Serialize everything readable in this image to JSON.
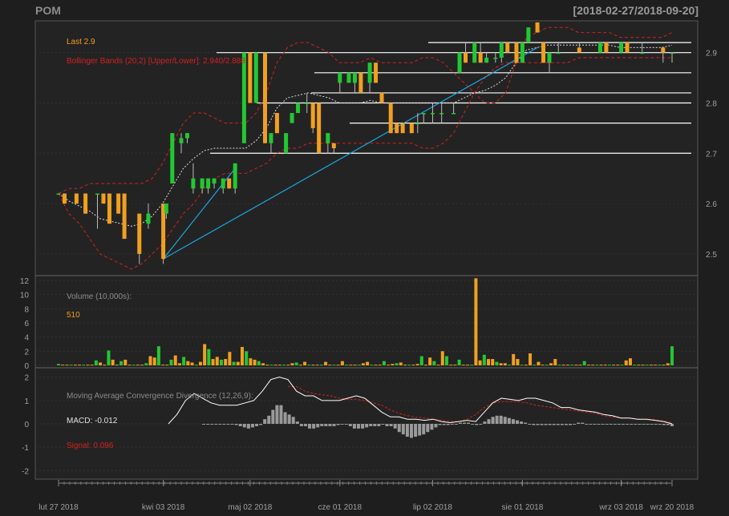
{
  "header": {
    "symbol": "POM",
    "range": "[2018-02-27/2018-09-20]"
  },
  "price_panel": {
    "last_label": "Last 2.9",
    "bb_label": "Bollinger Bands (20,2) [Upper/Lower]: 2.940/2.888",
    "yticks": [
      "2.5",
      "2.6",
      "2.7",
      "2.8",
      "2.9"
    ]
  },
  "volume_panel": {
    "title": "Volume (10,000s):",
    "value": "510",
    "yticks": [
      "0",
      "2",
      "4",
      "6",
      "8",
      "10",
      "12"
    ]
  },
  "macd_panel": {
    "title": "Moving Average Convergence Divergence (12,26,9):",
    "macd_label": "MACD: -0.012",
    "signal_label": "Signal: 0.096",
    "yticks": [
      "-2",
      "-1",
      "0",
      "1",
      "2"
    ]
  },
  "xaxis": {
    "labels": [
      "lut 27 2018",
      "kwi 03 2018",
      "maj 02 2018",
      "cze 01 2018",
      "lip 02 2018",
      "sie 01 2018",
      "wrz 03 2018",
      "wrz 20 2018"
    ]
  },
  "colors": {
    "up": "#22c832",
    "down": "#f0a020",
    "bb": "#d42020",
    "trend": "#1aa8e0",
    "bg": "#1e1e1e",
    "panel": "#232323",
    "axis": "#a0a0a0"
  },
  "chart_data": [
    {
      "type": "candlestick",
      "title": "POM",
      "ylim": [
        2.46,
        2.96
      ],
      "candles": [
        {
          "date": "2018-02-27",
          "o": 2.62,
          "h": 2.62,
          "l": 2.62,
          "c": 2.62
        },
        {
          "date": "2018-03-01",
          "o": 2.62,
          "h": 2.62,
          "l": 2.6,
          "c": 2.6
        },
        {
          "date": "2018-03-05",
          "o": 2.62,
          "h": 2.62,
          "l": 2.6,
          "c": 2.6
        },
        {
          "date": "2018-03-08",
          "o": 2.62,
          "h": 2.62,
          "l": 2.58,
          "c": 2.58
        },
        {
          "date": "2018-03-12",
          "o": 2.62,
          "h": 2.62,
          "l": 2.55,
          "c": 2.62
        },
        {
          "date": "2018-03-14",
          "o": 2.62,
          "h": 2.62,
          "l": 2.6,
          "c": 2.6
        },
        {
          "date": "2018-03-16",
          "o": 2.62,
          "h": 2.62,
          "l": 2.56,
          "c": 2.56
        },
        {
          "date": "2018-03-19",
          "o": 2.62,
          "h": 2.62,
          "l": 2.58,
          "c": 2.58
        },
        {
          "date": "2018-03-21",
          "o": 2.62,
          "h": 2.62,
          "l": 2.53,
          "c": 2.53
        },
        {
          "date": "2018-03-26",
          "o": 2.58,
          "h": 2.58,
          "l": 2.48,
          "c": 2.5
        },
        {
          "date": "2018-03-29",
          "o": 2.56,
          "h": 2.6,
          "l": 2.55,
          "c": 2.58
        },
        {
          "date": "2018-04-03",
          "o": 2.6,
          "h": 2.6,
          "l": 2.48,
          "c": 2.49
        },
        {
          "date": "2018-04-04",
          "o": 2.58,
          "h": 2.6,
          "l": 2.57,
          "c": 2.6
        },
        {
          "date": "2018-04-06",
          "o": 2.64,
          "h": 2.74,
          "l": 2.64,
          "c": 2.74
        },
        {
          "date": "2018-04-09",
          "o": 2.72,
          "h": 2.74,
          "l": 2.7,
          "c": 2.73
        },
        {
          "date": "2018-04-11",
          "o": 2.73,
          "h": 2.74,
          "l": 2.72,
          "c": 2.74
        },
        {
          "date": "2018-04-13",
          "o": 2.63,
          "h": 2.68,
          "l": 2.62,
          "c": 2.65
        },
        {
          "date": "2018-04-16",
          "o": 2.63,
          "h": 2.65,
          "l": 2.62,
          "c": 2.65
        },
        {
          "date": "2018-04-18",
          "o": 2.63,
          "h": 2.65,
          "l": 2.62,
          "c": 2.65
        },
        {
          "date": "2018-04-20",
          "o": 2.64,
          "h": 2.65,
          "l": 2.63,
          "c": 2.65
        },
        {
          "date": "2018-04-23",
          "o": 2.63,
          "h": 2.65,
          "l": 2.62,
          "c": 2.65
        },
        {
          "date": "2018-04-25",
          "o": 2.65,
          "h": 2.65,
          "l": 2.63,
          "c": 2.63
        },
        {
          "date": "2018-04-27",
          "o": 2.63,
          "h": 2.68,
          "l": 2.62,
          "c": 2.68
        },
        {
          "date": "2018-04-30",
          "o": 2.72,
          "h": 2.9,
          "l": 2.72,
          "c": 2.9
        },
        {
          "date": "2018-05-02",
          "o": 2.9,
          "h": 2.9,
          "l": 2.8,
          "c": 2.8
        },
        {
          "date": "2018-05-04",
          "o": 2.8,
          "h": 2.9,
          "l": 2.8,
          "c": 2.9
        },
        {
          "date": "2018-05-07",
          "o": 2.9,
          "h": 2.9,
          "l": 2.72,
          "c": 2.72
        },
        {
          "date": "2018-05-09",
          "o": 2.72,
          "h": 2.74,
          "l": 2.7,
          "c": 2.74
        },
        {
          "date": "2018-05-11",
          "o": 2.78,
          "h": 2.78,
          "l": 2.74,
          "c": 2.74
        },
        {
          "date": "2018-05-14",
          "o": 2.7,
          "h": 2.74,
          "l": 2.7,
          "c": 2.74
        },
        {
          "date": "2018-05-16",
          "o": 2.76,
          "h": 2.78,
          "l": 2.76,
          "c": 2.78
        },
        {
          "date": "2018-05-18",
          "o": 2.78,
          "h": 2.8,
          "l": 2.78,
          "c": 2.8
        },
        {
          "date": "2018-05-21",
          "o": 2.8,
          "h": 2.82,
          "l": 2.78,
          "c": 2.8
        },
        {
          "date": "2018-05-23",
          "o": 2.8,
          "h": 2.8,
          "l": 2.74,
          "c": 2.75
        },
        {
          "date": "2018-05-25",
          "o": 2.8,
          "h": 2.8,
          "l": 2.7,
          "c": 2.7
        },
        {
          "date": "2018-05-28",
          "o": 2.72,
          "h": 2.74,
          "l": 2.7,
          "c": 2.74
        },
        {
          "date": "2018-05-30",
          "o": 2.72,
          "h": 2.72,
          "l": 2.7,
          "c": 2.71
        },
        {
          "date": "2018-06-01",
          "o": 2.84,
          "h": 2.86,
          "l": 2.82,
          "c": 2.86
        },
        {
          "date": "2018-06-04",
          "o": 2.84,
          "h": 2.86,
          "l": 2.84,
          "c": 2.86
        },
        {
          "date": "2018-06-06",
          "o": 2.84,
          "h": 2.86,
          "l": 2.82,
          "c": 2.86
        },
        {
          "date": "2018-06-08",
          "o": 2.86,
          "h": 2.86,
          "l": 2.82,
          "c": 2.82
        },
        {
          "date": "2018-06-11",
          "o": 2.84,
          "h": 2.88,
          "l": 2.82,
          "c": 2.88
        },
        {
          "date": "2018-06-13",
          "o": 2.88,
          "h": 2.88,
          "l": 2.84,
          "c": 2.84
        },
        {
          "date": "2018-06-15",
          "o": 2.82,
          "h": 2.82,
          "l": 2.8,
          "c": 2.8
        },
        {
          "date": "2018-06-18",
          "o": 2.8,
          "h": 2.8,
          "l": 2.74,
          "c": 2.74
        },
        {
          "date": "2018-06-20",
          "o": 2.76,
          "h": 2.76,
          "l": 2.74,
          "c": 2.74
        },
        {
          "date": "2018-06-22",
          "o": 2.76,
          "h": 2.76,
          "l": 2.74,
          "c": 2.74
        },
        {
          "date": "2018-06-25",
          "o": 2.76,
          "h": 2.76,
          "l": 2.74,
          "c": 2.74
        },
        {
          "date": "2018-06-27",
          "o": 2.76,
          "h": 2.78,
          "l": 2.74,
          "c": 2.76
        },
        {
          "date": "2018-06-29",
          "o": 2.78,
          "h": 2.78,
          "l": 2.76,
          "c": 2.78
        },
        {
          "date": "2018-07-02",
          "o": 2.78,
          "h": 2.8,
          "l": 2.76,
          "c": 2.78
        },
        {
          "date": "2018-07-05",
          "o": 2.78,
          "h": 2.8,
          "l": 2.76,
          "c": 2.78
        },
        {
          "date": "2018-07-09",
          "o": 2.78,
          "h": 2.8,
          "l": 2.78,
          "c": 2.78
        },
        {
          "date": "2018-07-11",
          "o": 2.86,
          "h": 2.9,
          "l": 2.86,
          "c": 2.9
        },
        {
          "date": "2018-07-13",
          "o": 2.9,
          "h": 2.92,
          "l": 2.88,
          "c": 2.88
        },
        {
          "date": "2018-07-16",
          "o": 2.88,
          "h": 2.92,
          "l": 2.88,
          "c": 2.92
        },
        {
          "date": "2018-07-18",
          "o": 2.9,
          "h": 2.92,
          "l": 2.88,
          "c": 2.88
        },
        {
          "date": "2018-07-20",
          "o": 2.88,
          "h": 2.9,
          "l": 2.88,
          "c": 2.89
        },
        {
          "date": "2018-07-23",
          "o": 2.89,
          "h": 2.9,
          "l": 2.88,
          "c": 2.89
        },
        {
          "date": "2018-07-25",
          "o": 2.89,
          "h": 2.92,
          "l": 2.88,
          "c": 2.92
        },
        {
          "date": "2018-07-27",
          "o": 2.92,
          "h": 2.92,
          "l": 2.9,
          "c": 2.9
        },
        {
          "date": "2018-07-30",
          "o": 2.92,
          "h": 2.92,
          "l": 2.88,
          "c": 2.88
        },
        {
          "date": "2018-08-01",
          "o": 2.88,
          "h": 2.92,
          "l": 2.88,
          "c": 2.92
        },
        {
          "date": "2018-08-03",
          "o": 2.92,
          "h": 2.95,
          "l": 2.92,
          "c": 2.95
        },
        {
          "date": "2018-08-06",
          "o": 2.96,
          "h": 2.96,
          "l": 2.94,
          "c": 2.94
        },
        {
          "date": "2018-08-08",
          "o": 2.92,
          "h": 2.92,
          "l": 2.88,
          "c": 2.88
        },
        {
          "date": "2018-08-10",
          "o": 2.88,
          "h": 2.9,
          "l": 2.86,
          "c": 2.9
        },
        {
          "date": "2018-08-13",
          "o": 2.9,
          "h": 2.92,
          "l": 2.9,
          "c": 2.9
        },
        {
          "date": "2018-08-20",
          "o": 2.91,
          "h": 2.92,
          "l": 2.9,
          "c": 2.9
        },
        {
          "date": "2018-08-27",
          "o": 2.9,
          "h": 2.92,
          "l": 2.9,
          "c": 2.92
        },
        {
          "date": "2018-08-29",
          "o": 2.92,
          "h": 2.92,
          "l": 2.9,
          "c": 2.9
        },
        {
          "date": "2018-09-03",
          "o": 2.9,
          "h": 2.92,
          "l": 2.9,
          "c": 2.92
        },
        {
          "date": "2018-09-05",
          "o": 2.92,
          "h": 2.92,
          "l": 2.9,
          "c": 2.9
        },
        {
          "date": "2018-09-10",
          "o": 2.9,
          "h": 2.92,
          "l": 2.9,
          "c": 2.9
        },
        {
          "date": "2018-09-17",
          "o": 2.91,
          "h": 2.91,
          "l": 2.88,
          "c": 2.9
        },
        {
          "date": "2018-09-20",
          "o": 2.9,
          "h": 2.9,
          "l": 2.88,
          "c": 2.9
        }
      ],
      "bollinger_upper": [
        2.62,
        2.63,
        2.63,
        2.64,
        2.64,
        2.64,
        2.64,
        2.64,
        2.64,
        2.65,
        2.68,
        2.72,
        2.76,
        2.78,
        2.78,
        2.77,
        2.76,
        2.76,
        2.76,
        2.78,
        2.82,
        2.88,
        2.91,
        2.92,
        2.92,
        2.91,
        2.9,
        2.88,
        2.88,
        2.88,
        2.89,
        2.88,
        2.88,
        2.88,
        2.88,
        2.89,
        2.89,
        2.88,
        2.86,
        2.84,
        2.82,
        2.8,
        2.8,
        2.82,
        2.88,
        2.93,
        2.94,
        2.95,
        2.95,
        2.95,
        2.94,
        2.94,
        2.94,
        2.94,
        2.93,
        2.93,
        2.93,
        2.93,
        2.93,
        2.94
      ],
      "bollinger_lower": [
        2.62,
        2.58,
        2.56,
        2.53,
        2.5,
        2.49,
        2.48,
        2.47,
        2.48,
        2.5,
        2.52,
        2.55,
        2.58,
        2.6,
        2.63,
        2.65,
        2.66,
        2.66,
        2.66,
        2.67,
        2.68,
        2.7,
        2.71,
        2.71,
        2.72,
        2.72,
        2.72,
        2.72,
        2.72,
        2.72,
        2.72,
        2.72,
        2.72,
        2.72,
        2.72,
        2.71,
        2.71,
        2.72,
        2.74,
        2.78,
        2.82,
        2.85,
        2.87,
        2.88,
        2.88,
        2.88,
        2.88,
        2.88,
        2.88,
        2.88,
        2.89,
        2.89,
        2.89,
        2.89,
        2.89,
        2.89,
        2.89,
        2.89,
        2.89,
        2.89
      ],
      "horizontal_levels": [
        2.7,
        2.76,
        2.8,
        2.82,
        2.86,
        2.9,
        2.92
      ],
      "trendlines": [
        {
          "from": {
            "date": "2018-04-03",
            "y": 2.49
          },
          "to": {
            "date": "2018-08-06",
            "y": 2.91
          }
        },
        {
          "from": {
            "date": "2018-04-03",
            "y": 2.49
          },
          "to": {
            "date": "2018-04-27",
            "y": 2.67
          }
        }
      ]
    },
    {
      "type": "bar",
      "title": "Volume (10,000s):",
      "ylim": [
        0,
        12
      ],
      "values": [
        0.2,
        0.1,
        0.1,
        0.1,
        0.1,
        0.1,
        0.1,
        0.1,
        0.1,
        0.7,
        0.4,
        0.1,
        2.1,
        0.8,
        0.1,
        0.6,
        0.8,
        0.1,
        0.1,
        0.1,
        0.1,
        0.3,
        1.3,
        1.1,
        2.7,
        0.1,
        0.1,
        0.8,
        1.4,
        0.3,
        1.2,
        0.6,
        0.4,
        0.1,
        0.5,
        3.0,
        2.3,
        0.9,
        1.2,
        0.8,
        0.9,
        1.9,
        0.5,
        0.5,
        2.6,
        2.0,
        1.0,
        0.8,
        0.6,
        0.3,
        0.1,
        0.1,
        0.1,
        0.1,
        0.1,
        0.1,
        0.3,
        0.4,
        0.1,
        0.5,
        0.1,
        0.1,
        0.1,
        0.1,
        0.5,
        0.1,
        0.1,
        0.1,
        0.6,
        0.1,
        0.1,
        0.1,
        0.1,
        0.3,
        0.5,
        0.1,
        0.1,
        0.1,
        0.6,
        0.1,
        0.2,
        0.3,
        0.4,
        0.1,
        0.1,
        0.1,
        0.2,
        1.3,
        0.1,
        1.1,
        0.6,
        0.1,
        2.0,
        1.3,
        0.1,
        0.1,
        0.8,
        0.1,
        0.1,
        0.1,
        12.3,
        0.7,
        1.5,
        0.9,
        0.9,
        0.5,
        0.3,
        0.3,
        0.1,
        1.6,
        0.9,
        0.1,
        0.1,
        1.7,
        0.1,
        0.5,
        0.1,
        0.1,
        0.3,
        0.9,
        0.1,
        0.1,
        0.1,
        0.1,
        0.1,
        0.1,
        0.6,
        0.1,
        0.1,
        0.1,
        0.1,
        0.1,
        0.1,
        0.1,
        0.1,
        0.1,
        0.7,
        1.0,
        0.1,
        0.1,
        0.1,
        0.1,
        0.1,
        0.1,
        0.1,
        0.1,
        0.3,
        2.7
      ]
    },
    {
      "type": "line",
      "title": "Moving Average Convergence Divergence (12,26,9):",
      "ylim": [
        -2.3,
        2.3
      ],
      "macd": [
        0,
        0.4,
        1.0,
        1.3,
        1.1,
        0.9,
        0.8,
        0.8,
        0.8,
        0.9,
        1.0,
        1.4,
        1.9,
        2.0,
        1.9,
        1.4,
        1.2,
        1.2,
        1.0,
        1.0,
        1.0,
        1.1,
        1.2,
        1.1,
        0.8,
        0.5,
        0.3,
        0.3,
        0.2,
        0.2,
        0.15,
        0.2,
        0.1,
        0.05,
        0.1,
        0.15,
        0.1,
        0.5,
        0.9,
        1.1,
        1.05,
        1.0,
        1.1,
        1.1,
        1.0,
        0.9,
        0.7,
        0.7,
        0.6,
        0.55,
        0.5,
        0.4,
        0.35,
        0.25,
        0.25,
        0.2,
        0.2,
        0.15,
        0.1,
        0.0
      ],
      "signal": [
        null,
        null,
        null,
        null,
        null,
        null,
        null,
        null,
        null,
        null,
        null,
        null,
        null,
        null,
        1.6,
        1.6,
        1.4,
        1.3,
        1.25,
        1.2,
        1.1,
        1.05,
        1.05,
        1.0,
        0.9,
        0.8,
        0.6,
        0.45,
        0.35,
        0.28,
        0.25,
        0.2,
        0.15,
        0.1,
        0.1,
        0.2,
        0.4,
        0.7,
        0.9,
        0.95,
        0.95,
        0.95,
        0.9,
        0.8,
        0.75,
        0.7,
        0.65,
        0.6,
        0.55,
        0.5,
        0.45,
        0.35,
        0.3,
        0.25,
        0.25,
        0.2,
        0.2,
        0.18,
        0.12,
        0.05
      ],
      "histogram": [
        0,
        0,
        0,
        0,
        0,
        0,
        0,
        0,
        -0.05,
        -0.1,
        -0.15,
        -0.2,
        -0.15,
        -0.1,
        -0.05,
        0.2,
        0.35,
        0.6,
        0.8,
        0.8,
        0.5,
        0.4,
        0.3,
        0.1,
        -0.1,
        -0.1,
        -0.2,
        -0.2,
        -0.15,
        -0.1,
        -0.1,
        -0.1,
        -0.1,
        -0.05,
        0,
        0,
        -0.1,
        -0.2,
        -0.2,
        -0.2,
        -0.15,
        -0.1,
        -0.1,
        -0.1,
        0,
        -0.1,
        -0.1,
        -0.2,
        -0.35,
        -0.45,
        -0.55,
        -0.6,
        -0.55,
        -0.5,
        -0.45,
        -0.35,
        -0.25,
        -0.15,
        -0.05,
        -0.05,
        -0.05,
        0,
        0,
        0.05,
        0.05,
        0.05,
        0.0,
        -0.05,
        0,
        0.1,
        0.2,
        0.3,
        0.35,
        0.35,
        0.3,
        0.25,
        0.2,
        0.15,
        0.1,
        0.05,
        0,
        -0.05,
        -0.05,
        -0.05,
        -0.05,
        -0.05,
        -0.05,
        -0.05,
        -0.05,
        -0.05,
        -0.05,
        0,
        0.05,
        0.05,
        0,
        0,
        0,
        0,
        0,
        0,
        0,
        0,
        0,
        0,
        0,
        0,
        0,
        0,
        0,
        0,
        0,
        0,
        0,
        -0.05,
        -0.05,
        -0.1
      ]
    }
  ]
}
